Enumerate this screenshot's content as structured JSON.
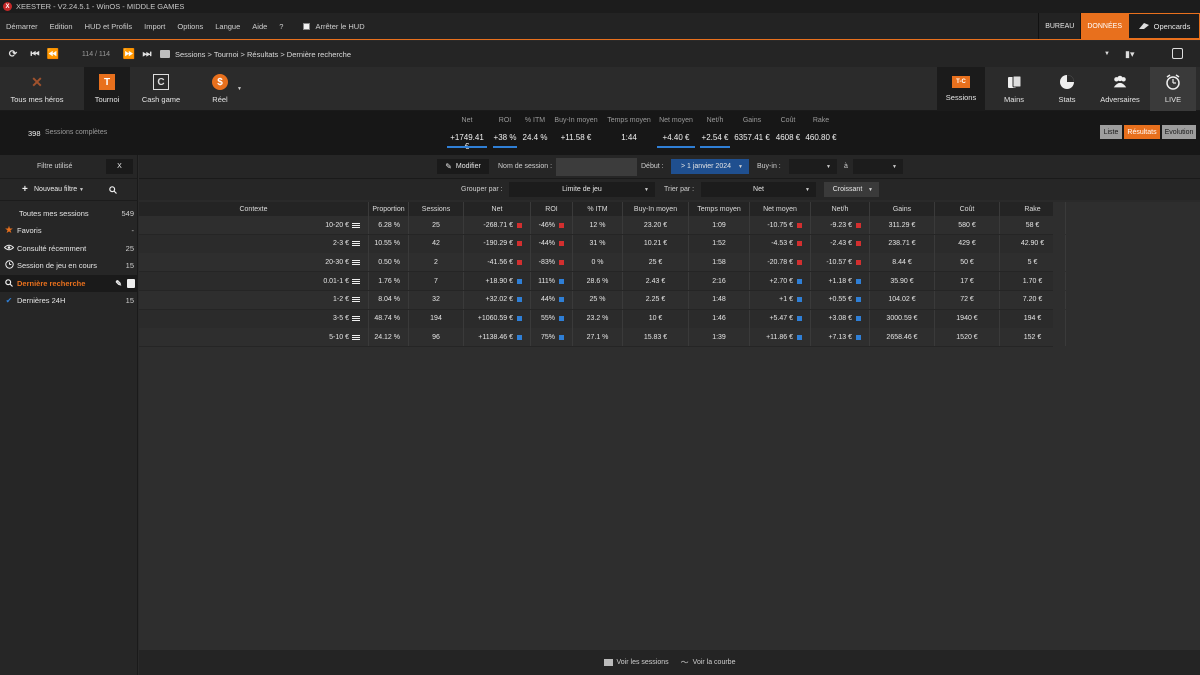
{
  "window": {
    "title": "XEESTER - V2.24.5.1 - WinOS - MIDDLE GAMES",
    "logo_letter": "X"
  },
  "menu": {
    "items": [
      "Démarrer",
      "Edition",
      "HUD et Profils",
      "Import",
      "Options",
      "Langue",
      "Aide",
      "?"
    ],
    "hud_toggle": "Arrêter le HUD",
    "right": {
      "bureau": "BUREAU",
      "donnees": "DONNÉES",
      "opencards": "Opencards"
    }
  },
  "nav": {
    "pager": "114 / 114",
    "breadcrumb": "Sessions > Tournoi > Résultats > Dernière recherche"
  },
  "toolbar": {
    "left": [
      {
        "label": "Tous mes héros",
        "icon": "crossed-swords-icon"
      },
      {
        "label": "Tournoi",
        "icon": "tournament-icon",
        "glyph": "T"
      },
      {
        "label": "Cash game",
        "icon": "cash-game-icon",
        "glyph": "C"
      },
      {
        "label": "Réel",
        "icon": "dollar-icon",
        "glyph": "$"
      }
    ],
    "right": [
      {
        "label": "Sessions",
        "icon": "sessions-icon",
        "glyph": "T-C"
      },
      {
        "label": "Mains",
        "icon": "cards-icon"
      },
      {
        "label": "Stats",
        "icon": "pie-chart-icon"
      },
      {
        "label": "Adversaires",
        "icon": "users-icon"
      },
      {
        "label": "LIVE",
        "icon": "alarm-clock-icon"
      }
    ]
  },
  "summary": {
    "count": "398",
    "count_label": "Sessions complètes",
    "stats": [
      {
        "h": "Net",
        "v": "+1749.41 €"
      },
      {
        "h": "ROI",
        "v": "+38 %"
      },
      {
        "h": "% ITM",
        "v": "24.4 %"
      },
      {
        "h": "Buy-In moyen",
        "v": "+11.58 €"
      },
      {
        "h": "Temps moyen",
        "v": "1:44"
      },
      {
        "h": "Net moyen",
        "v": "+4.40 €"
      },
      {
        "h": "Net/h",
        "v": "+2.54 €"
      },
      {
        "h": "Gains",
        "v": "6357.41 €"
      },
      {
        "h": "Coût",
        "v": "4608 €"
      },
      {
        "h": "Rake",
        "v": "460.80 €"
      }
    ],
    "views": {
      "liste": "Liste",
      "resultats": "Résultats",
      "evolution": "Evolution"
    }
  },
  "sidebar": {
    "filter_label": "Filtre utilisé",
    "filter_clear": "X",
    "new_filter": "Nouveau filtre",
    "items": [
      {
        "label": "Toutes mes sessions",
        "count": "549",
        "icon": ""
      },
      {
        "label": "Favoris",
        "count": "-",
        "icon": "star-icon"
      },
      {
        "label": "Consulté récemment",
        "count": "25",
        "icon": "eye-icon"
      },
      {
        "label": "Session de jeu en cours",
        "count": "15",
        "icon": "clock-icon"
      },
      {
        "label": "Dernière recherche",
        "count": "",
        "icon": "search-icon"
      },
      {
        "label": "Dernières 24H",
        "count": "15",
        "icon": "check-icon"
      }
    ]
  },
  "filters": {
    "modify": "Modifier",
    "session_name_label": "Nom de session :",
    "start_label": "Début :",
    "start_value": "> 1 janvier 2024",
    "buyin_label": "Buy-in :",
    "to_label": "à",
    "group_label": "Grouper par :",
    "group_value": "Limite de jeu",
    "sort_label": "Trier par :",
    "sort_value": "Net",
    "order_value": "Croissant"
  },
  "table": {
    "columns": [
      "Contexte",
      "Proportion",
      "Sessions",
      "Net",
      "ROI",
      "% ITM",
      "Buy-In moyen",
      "Temps moyen",
      "Net moyen",
      "Net/h",
      "Gains",
      "Coût",
      "Rake"
    ],
    "rows": [
      {
        "ctx": "10-20 €",
        "prop": "6.28 %",
        "sessions": "25",
        "net": "-268.71 €",
        "roi": "-46%",
        "itm": "12 %",
        "buyin": "23.20 €",
        "temps": "1:09",
        "netm": "-10.75 €",
        "neth": "-9.23 €",
        "gains": "311.29 €",
        "cout": "580 €",
        "rake": "58 €",
        "sign": "neg"
      },
      {
        "ctx": "2-3 €",
        "prop": "10.55 %",
        "sessions": "42",
        "net": "-190.29 €",
        "roi": "-44%",
        "itm": "31 %",
        "buyin": "10.21 €",
        "temps": "1:52",
        "netm": "-4.53 €",
        "neth": "-2.43 €",
        "gains": "238.71 €",
        "cout": "429 €",
        "rake": "42.90 €",
        "sign": "neg"
      },
      {
        "ctx": "20-30 €",
        "prop": "0.50 %",
        "sessions": "2",
        "net": "-41.56 €",
        "roi": "-83%",
        "itm": "0 %",
        "buyin": "25 €",
        "temps": "1:58",
        "netm": "-20.78 €",
        "neth": "-10.57 €",
        "gains": "8.44 €",
        "cout": "50 €",
        "rake": "5 €",
        "sign": "neg"
      },
      {
        "ctx": "0.01-1 €",
        "prop": "1.76 %",
        "sessions": "7",
        "net": "+18.90 €",
        "roi": "111%",
        "itm": "28.6 %",
        "buyin": "2.43 €",
        "temps": "2:16",
        "netm": "+2.70 €",
        "neth": "+1.18 €",
        "gains": "35.90 €",
        "cout": "17 €",
        "rake": "1.70 €",
        "sign": "pos"
      },
      {
        "ctx": "1-2 €",
        "prop": "8.04 %",
        "sessions": "32",
        "net": "+32.02 €",
        "roi": "44%",
        "itm": "25 %",
        "buyin": "2.25 €",
        "temps": "1:48",
        "netm": "+1 €",
        "neth": "+0.55 €",
        "gains": "104.02 €",
        "cout": "72 €",
        "rake": "7.20 €",
        "sign": "pos"
      },
      {
        "ctx": "3-5 €",
        "prop": "48.74 %",
        "sessions": "194",
        "net": "+1060.59 €",
        "roi": "55%",
        "itm": "23.2 %",
        "buyin": "10 €",
        "temps": "1:46",
        "netm": "+5.47 €",
        "neth": "+3.08 €",
        "gains": "3000.59 €",
        "cout": "1940 €",
        "rake": "194 €",
        "sign": "pos"
      },
      {
        "ctx": "5-10 €",
        "prop": "24.12 %",
        "sessions": "96",
        "net": "+1138.46 €",
        "roi": "75%",
        "itm": "27.1 %",
        "buyin": "15.83 €",
        "temps": "1:39",
        "netm": "+11.86 €",
        "neth": "+7.13 €",
        "gains": "2658.46 €",
        "cout": "1520 €",
        "rake": "152 €",
        "sign": "pos"
      }
    ]
  },
  "footer": {
    "sessions": "Voir les sessions",
    "curve": "Voir la courbe"
  },
  "colors": {
    "accent": "#e8701d",
    "positive": "#2f7fd6",
    "negative": "#d32f2f"
  }
}
